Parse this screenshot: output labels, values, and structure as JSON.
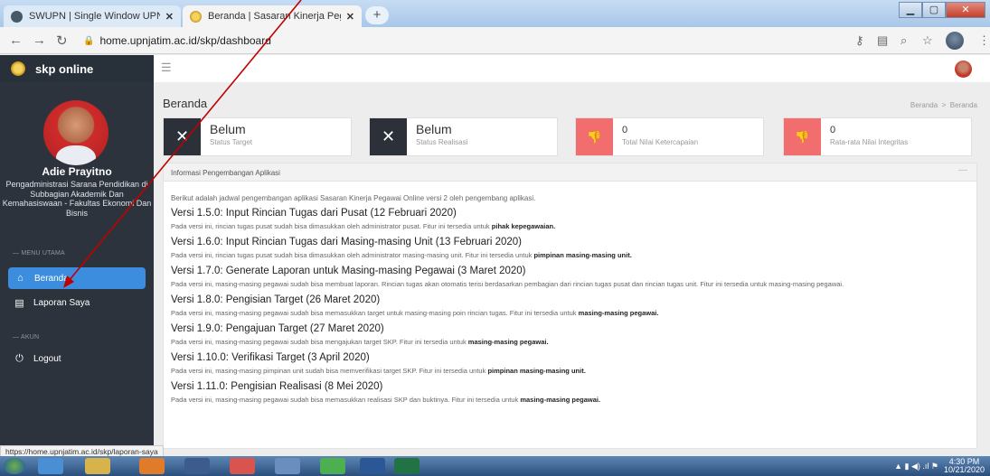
{
  "browser": {
    "tabs": [
      {
        "title": "SWUPN | Single Window UPN \"V",
        "close": "✕",
        "active": false
      },
      {
        "title": "Beranda | Sasaran Kinerja Pegaw",
        "close": "✕",
        "active": true
      }
    ],
    "new_tab": "+",
    "url": "home.upnjatim.ac.id/skp/dashboard",
    "status_url": "https://home.upnjatim.ac.id/skp/laporan-saya"
  },
  "sidebar": {
    "brand": "skp online",
    "user_name": "Adie Prayitno",
    "user_role": "Pengadministrasi Sarana Pendidikan di Subbagian Akademik Dan Kemahasiswaan - Fakultas Ekonomi Dan Bisnis",
    "section_main": "— MENU UTAMA",
    "items": [
      {
        "label": "Beranda",
        "icon": "home-icon",
        "active": true
      },
      {
        "label": "Laporan Saya",
        "icon": "document-icon",
        "active": false
      }
    ],
    "section_account": "— AKUN",
    "logout": "Logout"
  },
  "header": {
    "page_title": "Beranda",
    "breadcrumb_1": "Beranda",
    "breadcrumb_sep": ">",
    "breadcrumb_2": "Beranda"
  },
  "stats": [
    {
      "value": "Belum",
      "label": "Status Target",
      "icon": "x-icon",
      "color": "#2c3139"
    },
    {
      "value": "Belum",
      "label": "Status Realisasi",
      "icon": "x-icon",
      "color": "#2c3139"
    },
    {
      "value": "0",
      "label": "Total Nilai Ketercapaian",
      "icon": "thumbs-down-icon",
      "color": "#f26d6d"
    },
    {
      "value": "0",
      "label": "Rata-rata Nilai Integritas",
      "icon": "thumbs-down-icon",
      "color": "#f26d6d"
    }
  ],
  "panel": {
    "title": "Informasi Pengembangan Aplikasi",
    "collapse": "—",
    "intro": "Berikut adalah jadwal pengembangan aplikasi Sasaran Kinerja Pegawai Online versi 2 oleh pengembang aplikasi.",
    "versions": [
      {
        "title": "Versi 1.5.0: Input Rincian Tugas dari Pusat (12 Februari 2020)",
        "desc": "Pada versi ini, rincian tugas pusat sudah bisa dimasukkan oleh administrator pusat. Fitur ini tersedia untuk ",
        "bold": "pihak kepegawaian."
      },
      {
        "title": "Versi 1.6.0: Input Rincian Tugas dari Masing-masing Unit (13 Februari 2020)",
        "desc": "Pada versi ini, rincian tugas pusat sudah bisa dimasukkan oleh administrator masing-masing unit. Fitur ini tersedia untuk ",
        "bold": "pimpinan masing-masing unit."
      },
      {
        "title": "Versi 1.7.0: Generate Laporan untuk Masing-masing Pegawai (3 Maret 2020)",
        "desc": "Pada versi ini, masing-masing pegawai sudah bisa membuat laporan. Rincian tugas akan otomatis terisi berdasarkan pembagian dari rincian tugas pusat dan rincian tugas unit. Fitur ini tersedia untuk masing-masing pegawai.",
        "bold": ""
      },
      {
        "title": "Versi 1.8.0: Pengisian Target (26 Maret 2020)",
        "desc": "Pada versi ini, masing-masing pegawai sudah bisa memasukkan target untuk masing-masing poin rincian tugas. Fitur ini tersedia untuk ",
        "bold": "masing-masing pegawai."
      },
      {
        "title": "Versi 1.9.0: Pengajuan Target (27 Maret 2020)",
        "desc": "Pada versi ini, masing-masing pegawai sudah bisa mengajukan target SKP. Fitur ini tersedia untuk ",
        "bold": "masing-masing pegawai."
      },
      {
        "title": "Versi 1.10.0: Verifikasi Target (3 April 2020)",
        "desc": "Pada versi ini, masing-masing pimpinan unit sudah bisa memverifikasi target SKP. Fitur ini tersedia untuk ",
        "bold": "pimpinan masing-masing unit."
      },
      {
        "title": "Versi 1.11.0: Pengisian Realisasi (8 Mei 2020)",
        "desc": "Pada versi ini, masing-masing pegawai sudah bisa memasukkan realisasi SKP dan buktinya. Fitur ini tersedia untuk ",
        "bold": "masing-masing pegawai."
      }
    ]
  },
  "taskbar": {
    "time": "4:30 PM",
    "date": "10/21/2020"
  },
  "colors": {
    "sidebar_bg": "#2d333c",
    "accent_blue": "#3c8dde",
    "stat_dark": "#2c3139",
    "stat_red": "#f26d6d",
    "annotation_red": "#c00000"
  }
}
